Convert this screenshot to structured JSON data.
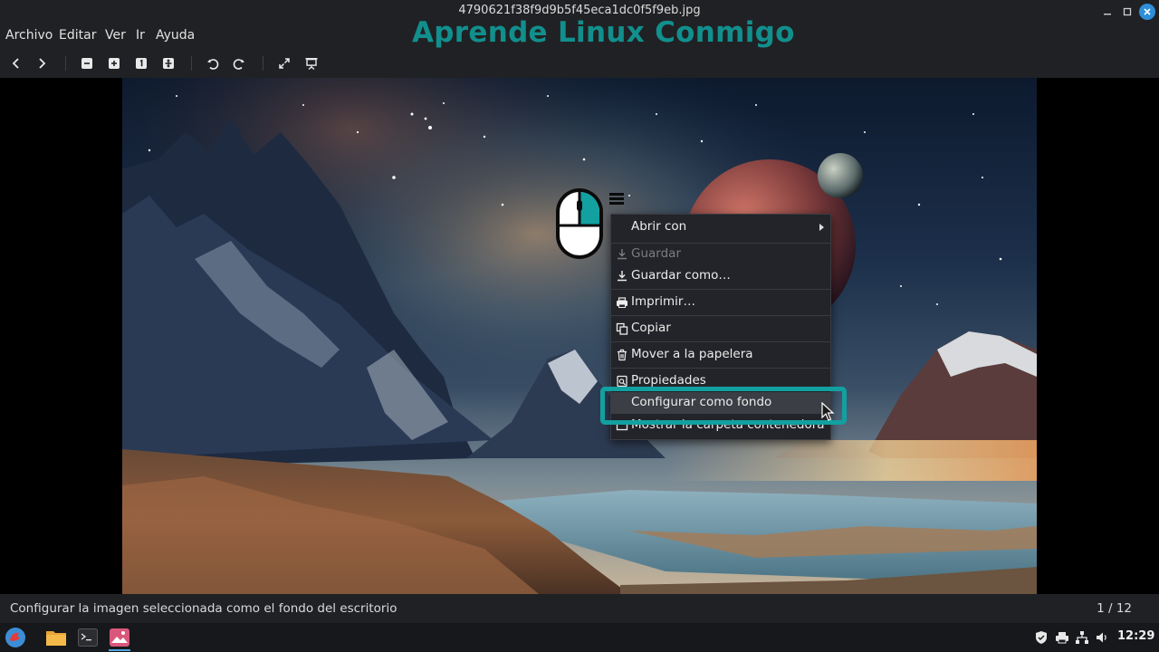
{
  "window": {
    "title": "4790621f38f9d9b5f45eca1dc0f5f9eb.jpg",
    "minimize_icon": "minimize-icon",
    "maximize_icon": "maximize-icon",
    "close_icon": "close-icon"
  },
  "watermark": "Aprende Linux Conmigo",
  "menubar": {
    "items": [
      "Archivo",
      "Editar",
      "Ver",
      "Ir",
      "Ayuda"
    ]
  },
  "toolbar": {
    "icons": [
      "back-arrow-icon",
      "forward-arrow-icon",
      "zoom-out-icon",
      "zoom-in-icon",
      "zoom-original-icon",
      "zoom-fit-icon",
      "rotate-left-icon",
      "rotate-right-icon",
      "fullscreen-icon",
      "slideshow-icon"
    ]
  },
  "context_menu": {
    "items": [
      {
        "label": "Abrir con",
        "icon": "",
        "enabled": true,
        "submenu": true
      },
      {
        "label": "Guardar",
        "icon": "save-icon",
        "enabled": false
      },
      {
        "label": "Guardar como…",
        "icon": "save-as-icon",
        "enabled": true
      },
      {
        "label": "Imprimir…",
        "icon": "print-icon",
        "enabled": true
      },
      {
        "label": "Copiar",
        "icon": "copy-icon",
        "enabled": true
      },
      {
        "label": "Mover a la papelera",
        "icon": "trash-icon",
        "enabled": true
      },
      {
        "label": "Propiedades",
        "icon": "properties-icon",
        "enabled": true
      },
      {
        "label": "Configurar como fondo",
        "icon": "",
        "enabled": true,
        "highlighted": true
      },
      {
        "label": "Mostrar la carpeta contenedora",
        "icon": "folder-icon",
        "enabled": true
      }
    ],
    "highlight_color": "#12a0a0"
  },
  "status": {
    "text": "Configurar la imagen seleccionada como el fondo del escritorio",
    "count": "1 / 12"
  },
  "taskbar": {
    "apps": [
      "menu-icon",
      "file-manager-icon",
      "terminal-icon",
      "image-viewer-icon"
    ],
    "tray": [
      "shield-icon",
      "printer-icon",
      "network-icon",
      "volume-icon"
    ],
    "clock": "12:29"
  },
  "colors": {
    "accent": "#12a0a0",
    "watermark": "#118f8d",
    "chrome": "#202124"
  }
}
